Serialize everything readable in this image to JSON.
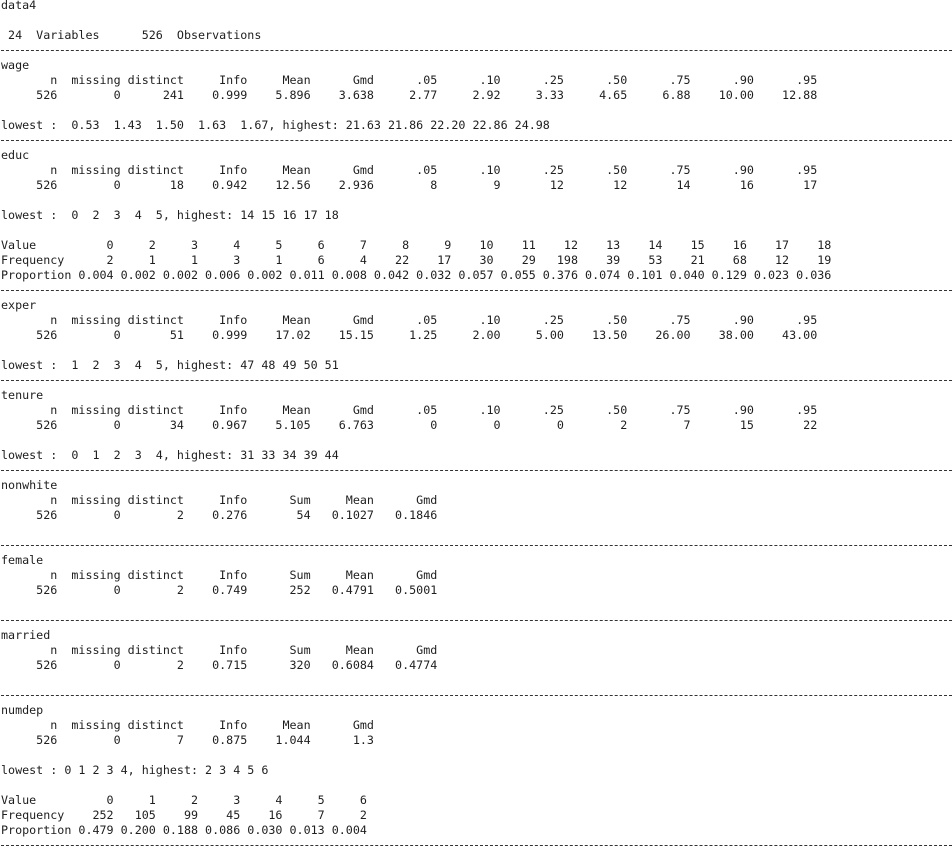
{
  "lines": [
    "data4",
    "",
    " 24  Variables      526  Observations",
    "---",
    "wage",
    "       n  missing distinct     Info     Mean      Gmd      .05      .10      .25      .50      .75      .90      .95",
    "     526        0      241    0.999    5.896    3.638     2.77     2.92     3.33     4.65     6.88    10.00    12.88",
    "",
    "lowest :  0.53  1.43  1.50  1.63  1.67, highest: 21.63 21.86 22.20 22.86 24.98",
    "---",
    "educ",
    "       n  missing distinct     Info     Mean      Gmd      .05      .10      .25      .50      .75      .90      .95",
    "     526        0       18    0.942    12.56    2.936        8        9       12       12       14       16       17",
    "",
    "lowest :  0  2  3  4  5, highest: 14 15 16 17 18",
    "",
    "Value          0     2     3     4     5     6     7     8     9    10    11    12    13    14    15    16    17    18",
    "Frequency      2     1     1     3     1     6     4    22    17    30    29   198    39    53    21    68    12    19",
    "Proportion 0.004 0.002 0.002 0.006 0.002 0.011 0.008 0.042 0.032 0.057 0.055 0.376 0.074 0.101 0.040 0.129 0.023 0.036",
    "---",
    "exper",
    "       n  missing distinct     Info     Mean      Gmd      .05      .10      .25      .50      .75      .90      .95",
    "     526        0       51    0.999    17.02    15.15     1.25     2.00     5.00    13.50    26.00    38.00    43.00",
    "",
    "lowest :  1  2  3  4  5, highest: 47 48 49 50 51",
    "---",
    "tenure",
    "       n  missing distinct     Info     Mean      Gmd      .05      .10      .25      .50      .75      .90      .95",
    "     526        0       34    0.967    5.105    6.763        0        0        0        2        7       15       22",
    "",
    "lowest :  0  1  2  3  4, highest: 31 33 34 39 44",
    "---",
    "nonwhite",
    "       n  missing distinct     Info      Sum     Mean      Gmd",
    "     526        0        2    0.276       54   0.1027   0.1846",
    "",
    "---",
    "female",
    "       n  missing distinct     Info      Sum     Mean      Gmd",
    "     526        0        2    0.749      252   0.4791   0.5001",
    "",
    "---",
    "married",
    "       n  missing distinct     Info      Sum     Mean      Gmd",
    "     526        0        2    0.715      320   0.6084   0.4774",
    "",
    "---",
    "numdep",
    "       n  missing distinct     Info     Mean      Gmd",
    "     526        0        7    0.875    1.044      1.3",
    "",
    "lowest : 0 1 2 3 4, highest: 2 3 4 5 6",
    "",
    "Value          0     1     2     3     4     5     6",
    "Frequency    252   105    99    45    16     7     2",
    "Proportion 0.479 0.200 0.188 0.086 0.030 0.013 0.004",
    "---"
  ]
}
